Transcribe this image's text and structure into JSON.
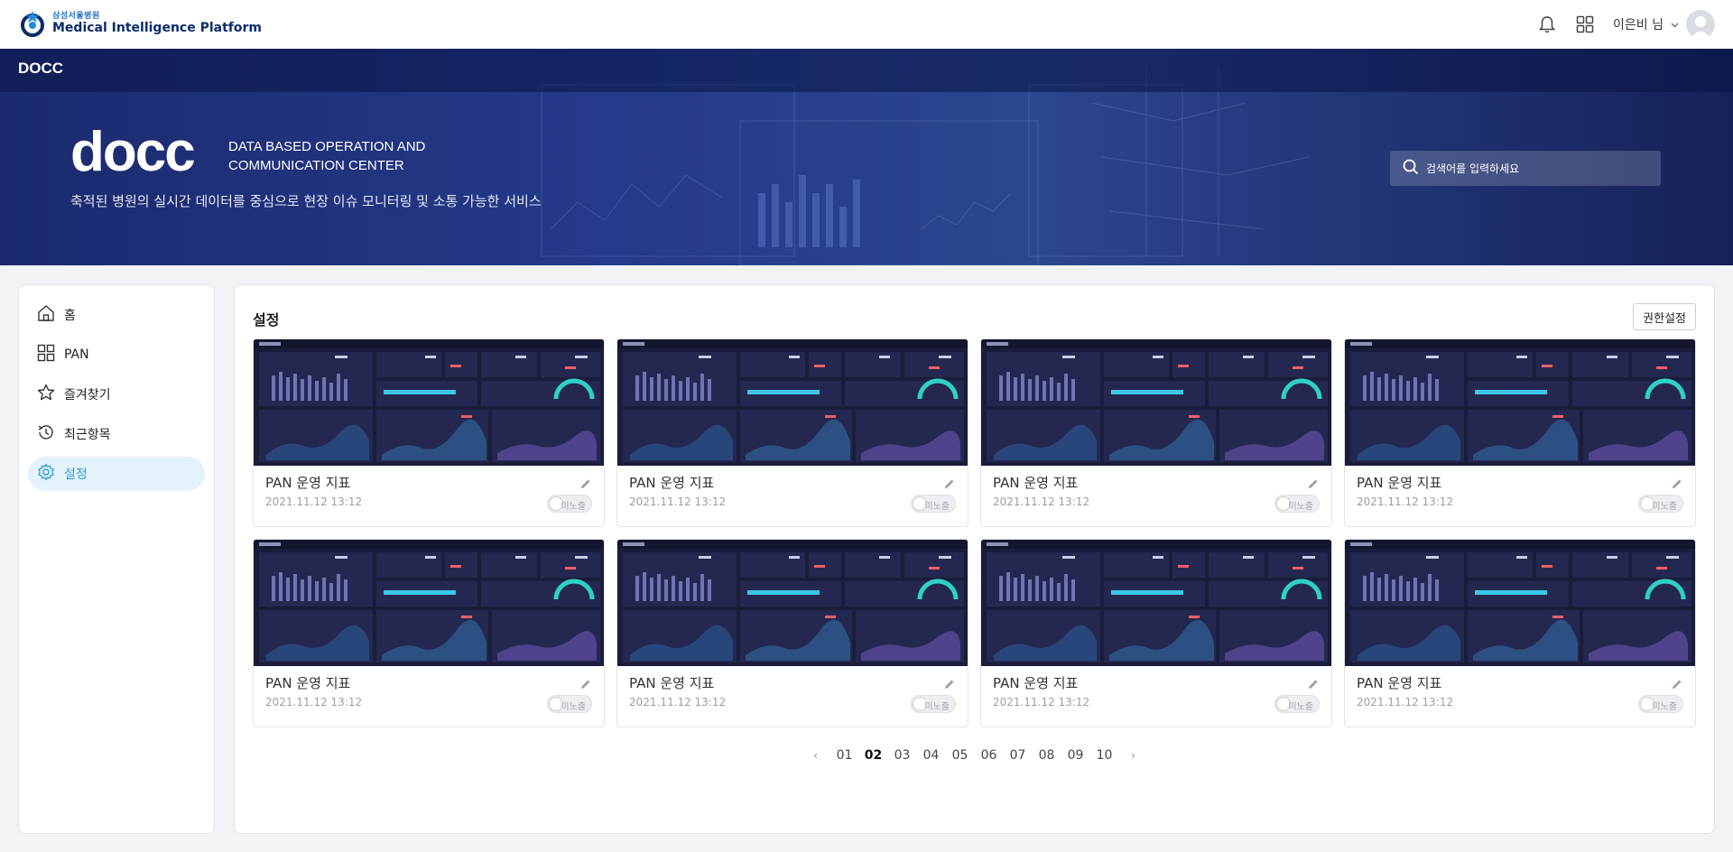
{
  "header": {
    "logo_sub": "삼성서울병원",
    "logo_title": "Medical Intelligence Platform",
    "user_name": "이은비 님"
  },
  "banner": {
    "section": "DOCC",
    "logo": "docc",
    "tagline_line1": "DATA BASED OPERATION AND",
    "tagline_line2": "COMMUNICATION CENTER",
    "description": "축적된 병원의 실시간 데이터를 중심으로 현장 이슈 모니터링 및 소통 가능한 서비스",
    "search_placeholder": "검색어를 입력하세요"
  },
  "sidebar": {
    "items": [
      {
        "label": "홈",
        "icon": "home-icon",
        "active": false
      },
      {
        "label": "PAN",
        "icon": "grid-icon",
        "active": false
      },
      {
        "label": "즐겨찾기",
        "icon": "star-icon",
        "active": false
      },
      {
        "label": "최근항목",
        "icon": "history-icon",
        "active": false
      },
      {
        "label": "설정",
        "icon": "gear-icon",
        "active": true
      }
    ]
  },
  "main": {
    "title": "설정",
    "permission_button": "권한설정",
    "cards": [
      {
        "title": "PAN 운영 지표",
        "date": "2021.11.12 13:12",
        "toggle": "미노출"
      },
      {
        "title": "PAN 운영 지표",
        "date": "2021.11.12 13:12",
        "toggle": "미노출"
      },
      {
        "title": "PAN 운영 지표",
        "date": "2021.11.12 13:12",
        "toggle": "미노출"
      },
      {
        "title": "PAN 운영 지표",
        "date": "2021.11.12 13:12",
        "toggle": "미노출"
      },
      {
        "title": "PAN 운영 지표",
        "date": "2021.11.12 13:12",
        "toggle": "미노출"
      },
      {
        "title": "PAN 운영 지표",
        "date": "2021.11.12 13:12",
        "toggle": "미노출"
      },
      {
        "title": "PAN 운영 지표",
        "date": "2021.11.12 13:12",
        "toggle": "미노출"
      },
      {
        "title": "PAN 운영 지표",
        "date": "2021.11.12 13:12",
        "toggle": "미노출"
      }
    ],
    "pagination": {
      "pages": [
        "01",
        "02",
        "03",
        "04",
        "05",
        "06",
        "07",
        "08",
        "09",
        "10"
      ],
      "current": "02"
    }
  },
  "colors": {
    "accent": "#2aa0d8",
    "banner_dark": "#1b2a6e",
    "thumb_bg": "#1a1d3a"
  }
}
